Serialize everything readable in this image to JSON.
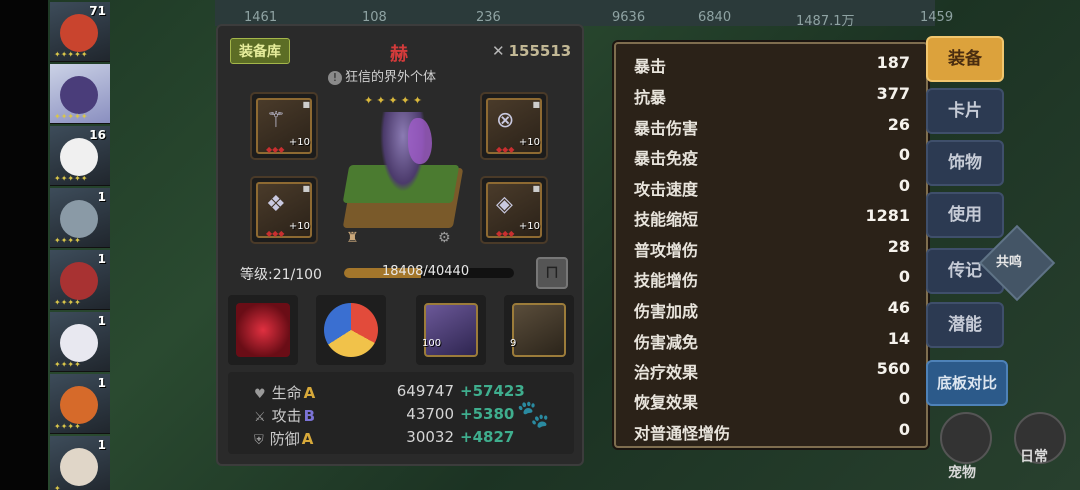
{
  "top_numbers": [
    "1461",
    "108",
    "236",
    "9636",
    "6840",
    "1487.1万",
    "1459"
  ],
  "roster": [
    {
      "level": "71",
      "stars": "✦✦✦✦✦",
      "color": "#c9442e"
    },
    {
      "level": "",
      "stars": "✦✦✦✦✦",
      "color": "#4a3d7a",
      "selected": true
    },
    {
      "level": "16",
      "stars": "✦✦✦✦✦",
      "color": "#f0f0f0"
    },
    {
      "level": "1",
      "stars": "✦✦✦✦",
      "color": "#8a9aa6"
    },
    {
      "level": "1",
      "stars": "✦✦✦✦",
      "color": "#a83232"
    },
    {
      "level": "1",
      "stars": "✦✦✦✦",
      "color": "#e8e8f0"
    },
    {
      "level": "1",
      "stars": "✦✦✦✦",
      "color": "#d66a2a"
    },
    {
      "level": "1",
      "stars": "✦",
      "color": "#e0d6c8"
    }
  ],
  "equip_panel": {
    "library_label": "装备库",
    "hero_name": "赫",
    "hero_subtitle": "狂信的界外个体",
    "warn_glyph": "!",
    "power_icon": "swords-icon",
    "power": "155513",
    "hero_stars": "✦✦✦✦✦",
    "slots": [
      {
        "plus": "+10",
        "dots": "◆◆◆",
        "icon": "trident-icon",
        "lock": "🔒"
      },
      {
        "plus": "+10",
        "dots": "◆◆◆",
        "icon": "ring-icon",
        "lock": "🔒"
      },
      {
        "plus": "+10",
        "dots": "◆◆◆",
        "icon": "armor-icon",
        "lock": "🔒"
      },
      {
        "plus": "+10",
        "dots": "◆◆◆",
        "icon": "necklace-icon",
        "lock": "🔒"
      }
    ],
    "level_label": "等级:21/100",
    "exp_text": "18408/40440",
    "exp_fraction": 0.455,
    "skills": [
      {
        "count": "",
        "color": "#b0202a"
      },
      {
        "count": "",
        "color": "#3a6fd1"
      },
      {
        "count": "100",
        "color": "#5e4a8a"
      },
      {
        "count": "9",
        "color": "#6a5c4a"
      }
    ],
    "stats": [
      {
        "icon": "heart-icon",
        "glyph": "♥",
        "name": "生命",
        "grade": "A",
        "grade_class": "gr-a",
        "base": "649747",
        "bonus": "+57423"
      },
      {
        "icon": "sword-icon",
        "glyph": "⚔",
        "name": "攻击",
        "grade": "B",
        "grade_class": "gr-b",
        "base": "43700",
        "bonus": "+5380"
      },
      {
        "icon": "shield-icon",
        "glyph": "⛨",
        "name": "防御",
        "grade": "A",
        "grade_class": "gr-a",
        "base": "30032",
        "bonus": "+4827"
      }
    ]
  },
  "attributes": [
    {
      "name": "暴击",
      "value": "187"
    },
    {
      "name": "抗暴",
      "value": "377"
    },
    {
      "name": "暴击伤害",
      "value": "26"
    },
    {
      "name": "暴击免疫",
      "value": "0"
    },
    {
      "name": "攻击速度",
      "value": "0"
    },
    {
      "name": "技能缩短",
      "value": "1281"
    },
    {
      "name": "普攻增伤",
      "value": "28"
    },
    {
      "name": "技能增伤",
      "value": "0"
    },
    {
      "name": "伤害加成",
      "value": "46"
    },
    {
      "name": "伤害减免",
      "value": "14"
    },
    {
      "name": "治疗效果",
      "value": "560"
    },
    {
      "name": "恢复效果",
      "value": "0"
    },
    {
      "name": "对普通怪增伤",
      "value": "0"
    }
  ],
  "tabs": [
    "装备",
    "卡片",
    "饰物",
    "使用",
    "传记",
    "潜能"
  ],
  "compare_label": "底板对比",
  "resonance_label": "共鸣",
  "bottom_right": [
    "宠物",
    "日常"
  ]
}
